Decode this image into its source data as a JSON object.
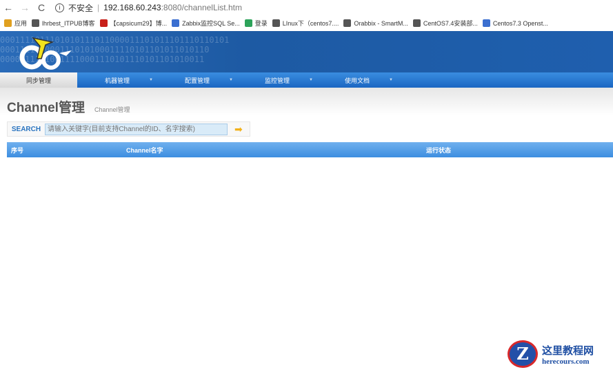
{
  "browser": {
    "back": "←",
    "forward": "→",
    "reload": "C",
    "security": "不安全",
    "host": "192.168.60.243",
    "path": ":8080/channelList.htm"
  },
  "bookmarks": [
    {
      "label": "应用",
      "icon": "apps-icon",
      "color": "#e0a020"
    },
    {
      "label": "lhrbest_ITPUB博客",
      "icon": "globe-icon",
      "color": "#555"
    },
    {
      "label": "【capsicum29】博...",
      "icon": "csdn-icon",
      "color": "#c8201a"
    },
    {
      "label": "Zabbix监控SQL Se...",
      "icon": "pen-icon",
      "color": "#3b6fd0"
    },
    {
      "label": "登录",
      "icon": "login-icon",
      "color": "#2da35a"
    },
    {
      "label": "LInux下（centos7....",
      "icon": "script-icon",
      "color": "#555"
    },
    {
      "label": "Orabbix - SmartM...",
      "icon": "globe-icon",
      "color": "#555"
    },
    {
      "label": "CentOS7.4安装部...",
      "icon": "script-icon",
      "color": "#555"
    },
    {
      "label": "Centos7.3 Openst...",
      "icon": "pen-icon",
      "color": "#3b6fd0"
    }
  ],
  "banner": {
    "bits": "0001111011101010111011000011101011101110110101\n000111100000111010100011110101101011010110\n00000111110011110001110101110101101010011"
  },
  "menu": [
    {
      "label": "同步管理",
      "active": true
    },
    {
      "label": "机器管理"
    },
    {
      "label": "配置管理"
    },
    {
      "label": "监控管理"
    },
    {
      "label": "使用文档"
    }
  ],
  "page": {
    "title": "Channel管理",
    "subtitle": "Channel管理"
  },
  "search": {
    "label": "SEARCH",
    "placeholder": "请输入关键字(目前支持Channel的ID、名字搜索)"
  },
  "table": {
    "columns": [
      "序号",
      "Channel名字",
      "运行状态"
    ]
  },
  "watermark": {
    "title": "这里教程网",
    "domain": "herecours.com"
  }
}
